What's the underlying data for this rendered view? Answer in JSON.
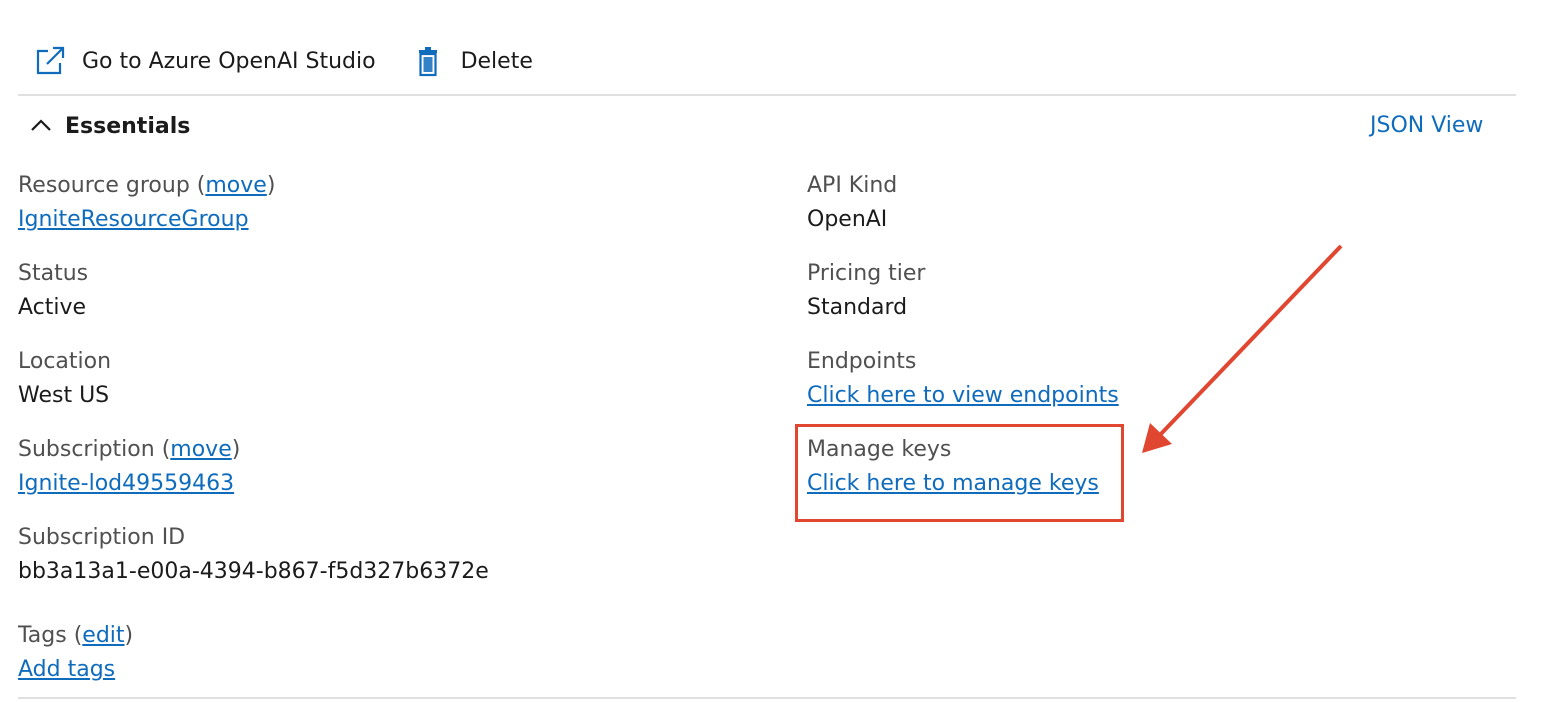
{
  "toolbar": {
    "open_studio": {
      "label": "Go to Azure OpenAI Studio",
      "icon": "open-external-icon"
    },
    "delete": {
      "label": "Delete",
      "icon": "trash-icon"
    }
  },
  "essentials": {
    "title": "Essentials",
    "json_view": "JSON View",
    "left": [
      {
        "label": "Resource group",
        "action": "move",
        "value": "IgniteResourceGroup",
        "value_is_link": true
      },
      {
        "label": "Status",
        "value": "Active"
      },
      {
        "label": "Location",
        "value": "West US"
      },
      {
        "label": "Subscription",
        "action": "move",
        "value": "Ignite-lod49559463",
        "value_is_link": true
      },
      {
        "label": "Subscription ID",
        "value": "bb3a13a1-e00a-4394-b867-f5d327b6372e"
      },
      {
        "label": "Tags",
        "action": "edit",
        "value": "Add tags",
        "value_is_link": true
      }
    ],
    "right": [
      {
        "label": "API Kind",
        "value": "OpenAI"
      },
      {
        "label": "Pricing tier",
        "value": "Standard"
      },
      {
        "label": "Endpoints",
        "value": "Click here to view endpoints",
        "value_is_link": true
      },
      {
        "label": "Manage keys",
        "value": "Click here to manage keys",
        "value_is_link": true
      }
    ]
  },
  "colors": {
    "link": "#0f6cbd",
    "annotation": "#e14631",
    "text": "#1b1b1b",
    "label": "#505050"
  }
}
